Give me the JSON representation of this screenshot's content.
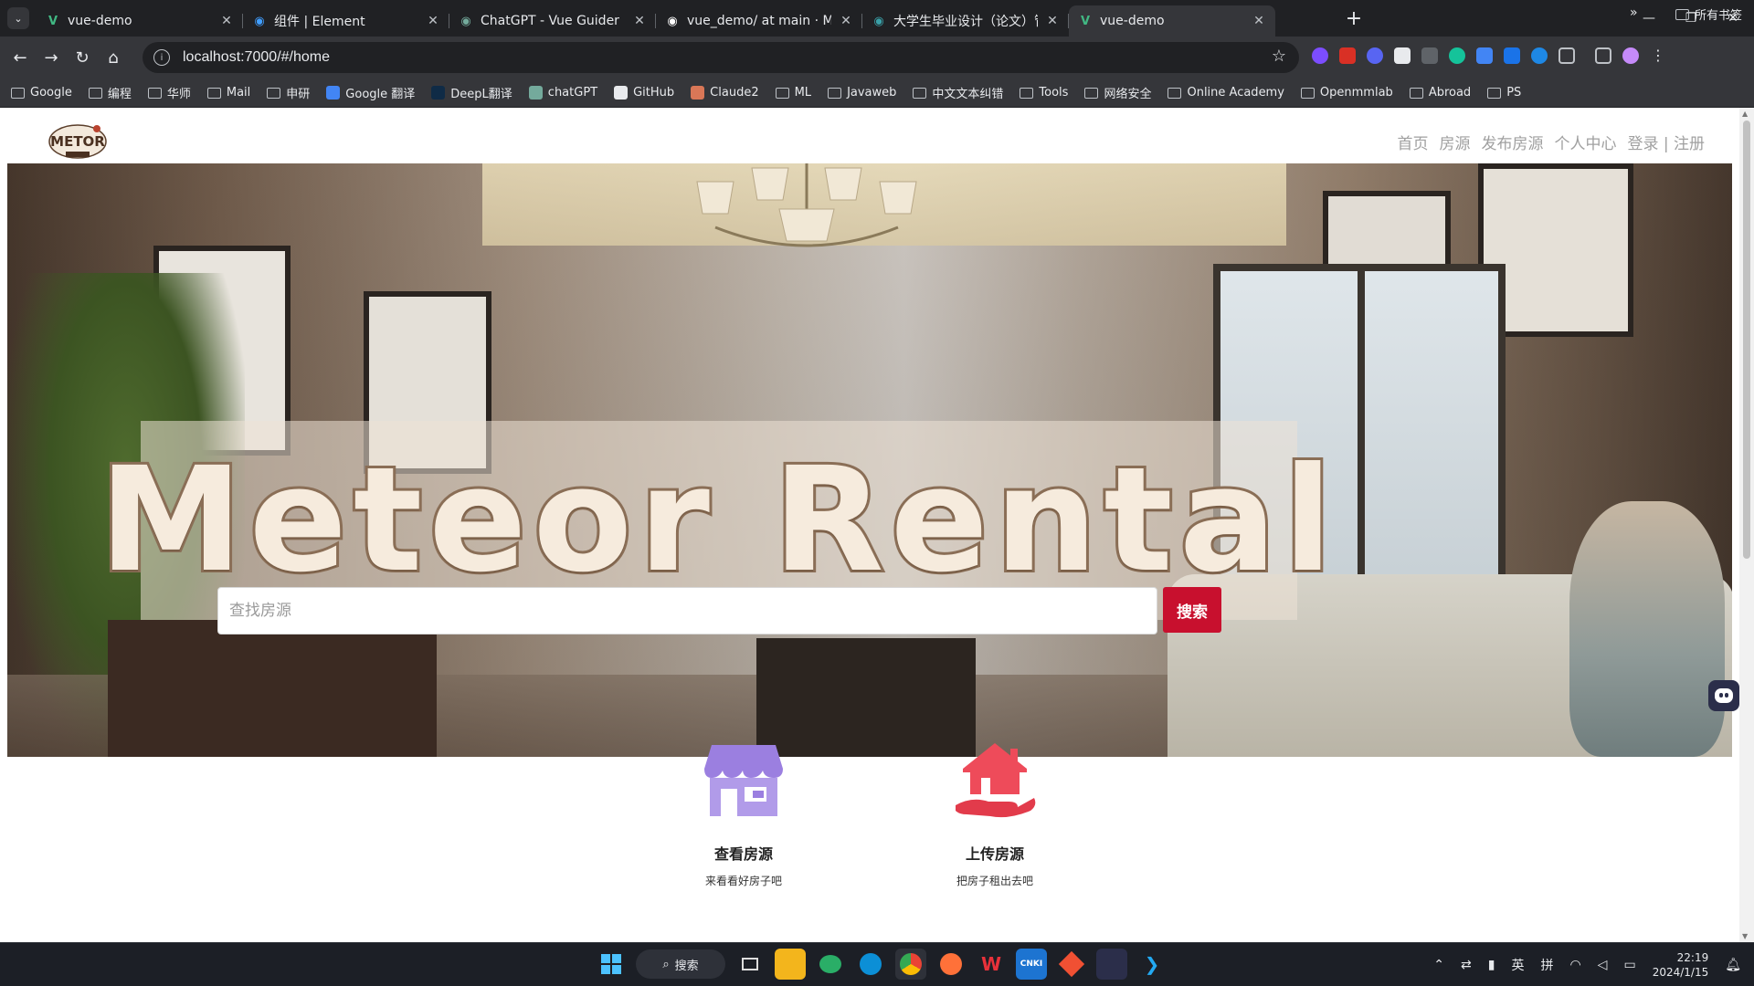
{
  "browser": {
    "tabs": [
      {
        "title": "vue-demo",
        "icon": "vue-icon",
        "color": "#41b883",
        "active": false
      },
      {
        "title": "组件 | Element",
        "icon": "element-icon",
        "color": "#409eff",
        "active": false
      },
      {
        "title": "ChatGPT - Vue Guider",
        "icon": "chatgpt-icon",
        "color": "#74aa9c",
        "active": false
      },
      {
        "title": "vue_demo/ at main · Meteor",
        "icon": "github-icon",
        "color": "#ffffff",
        "active": false
      },
      {
        "title": "大学生毕业设计（论文）管理系",
        "icon": "school-icon",
        "color": "#3aa0a8",
        "active": false
      },
      {
        "title": "vue-demo",
        "icon": "vue-icon",
        "color": "#41b883",
        "active": true
      }
    ],
    "new_tab": "+",
    "window_controls": [
      "—",
      "❐",
      "✕"
    ],
    "url": "localhost:7000/#/home",
    "bookmarks": [
      {
        "label": "Google",
        "icon": "folder-icon"
      },
      {
        "label": "编程",
        "icon": "folder-icon"
      },
      {
        "label": "华师",
        "icon": "folder-icon"
      },
      {
        "label": "Mail",
        "icon": "folder-icon"
      },
      {
        "label": "申研",
        "icon": "folder-icon"
      },
      {
        "label": "Google 翻译",
        "icon": "google-translate-icon"
      },
      {
        "label": "DeepL翻译",
        "icon": "deepl-icon"
      },
      {
        "label": "chatGPT",
        "icon": "chatgpt-icon"
      },
      {
        "label": "GitHub",
        "icon": "github-icon"
      },
      {
        "label": "Claude2",
        "icon": "claude-icon"
      },
      {
        "label": "ML",
        "icon": "folder-icon"
      },
      {
        "label": "Javaweb",
        "icon": "folder-icon"
      },
      {
        "label": "中文文本纠错",
        "icon": "folder-icon"
      },
      {
        "label": "Tools",
        "icon": "folder-icon"
      },
      {
        "label": "网络安全",
        "icon": "folder-icon"
      },
      {
        "label": "Online Academy",
        "icon": "folder-icon"
      },
      {
        "label": "Openmmlab",
        "icon": "folder-icon"
      },
      {
        "label": "Abroad",
        "icon": "folder-icon"
      },
      {
        "label": "PS",
        "icon": "folder-icon"
      }
    ],
    "bookmarks_more": "»",
    "all_bookmarks": "所有书签"
  },
  "site": {
    "nav": [
      "首页",
      "房源",
      "发布房源",
      "个人中心",
      "登录 | 注册"
    ],
    "hero_title": "Meteor Rental",
    "search_placeholder": "查找房源",
    "search_button": "搜索",
    "features": [
      {
        "title": "查看房源",
        "subtitle": "来看看好房子吧",
        "icon": "store-icon",
        "color": "#a98be3"
      },
      {
        "title": "上传房源",
        "subtitle": "把房子租出去吧",
        "icon": "house-hand-icon",
        "color": "#ee4b5a"
      }
    ]
  },
  "taskbar": {
    "search_label": "搜索",
    "tray": {
      "lang1": "英",
      "lang2": "拼"
    },
    "time": "22:19",
    "date": "2024/1/15"
  }
}
